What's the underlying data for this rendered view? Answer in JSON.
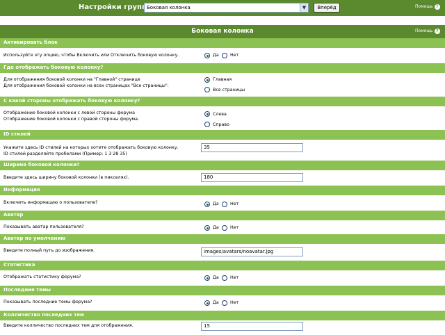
{
  "topbar": {
    "title": "Настройки группы",
    "select_value": "Боковая колонка",
    "next_button": "Вперёд",
    "help": "Помощь"
  },
  "panel": {
    "title": "Боковая колонка",
    "help": "Помощь"
  },
  "sections": {
    "activate": {
      "title": "Активировать блок",
      "text": "Используйте эту опцию, чтобы Включить или Отключить боковую колонку.",
      "yes": "Да",
      "no": "Нет"
    },
    "where": {
      "title": "Где отображать боковую колонку?",
      "text1": "Для отображения боковой колонки на \"Главной\" странице",
      "text2": "Для отображения боковой колонки на всех страницах \"Все страницы\".",
      "opt1": "Главная",
      "opt2": "Все страницы"
    },
    "side": {
      "title": "С какой стороны отображать боковую колонку?",
      "text1": "Отображение боковой колонки с левой стороны форума",
      "text2": "Отображение боковой колонки с правой стороны форума.",
      "opt1": "Слева",
      "opt2": "Справо"
    },
    "style_ids": {
      "title": "ID стилей",
      "text1": "Укажите здесь ID стилей на которых хотите отображать боковую колонку.",
      "text2": "ID стилей разделяйте пробелами (Пример: 1 3 28 35)",
      "value": "35"
    },
    "width": {
      "title": "Ширина боковой колонки?",
      "text": "Введите здесь ширину боковой колонки (в пикселях).",
      "value": "180"
    },
    "info": {
      "title": "Информация",
      "text": "Включить информацию о пользователе?",
      "yes": "Да",
      "no": "Нет"
    },
    "avatar": {
      "title": "Аватар",
      "text": "Показывать аватар пользователя?",
      "yes": "Да",
      "no": "Нет"
    },
    "default_avatar": {
      "title": "Аватар по умолчанию",
      "text": "Введите полный путь до изображения.",
      "value": "images/avatars/noavatar.jpg"
    },
    "stats": {
      "title": "Статистика",
      "text": "Отображать статистику форума?",
      "yes": "Да",
      "no": "Нет"
    },
    "recent": {
      "title": "Последние темы",
      "text": "Показывать последние темы форума?",
      "yes": "Да",
      "no": "Нет"
    },
    "recent_count": {
      "title": "Колличество последних тем",
      "text": "Введите колличество последних тем для отображения.",
      "value": "15"
    }
  },
  "colors": {
    "header_green": "#5b8a2e",
    "section_green": "#8cc153"
  }
}
